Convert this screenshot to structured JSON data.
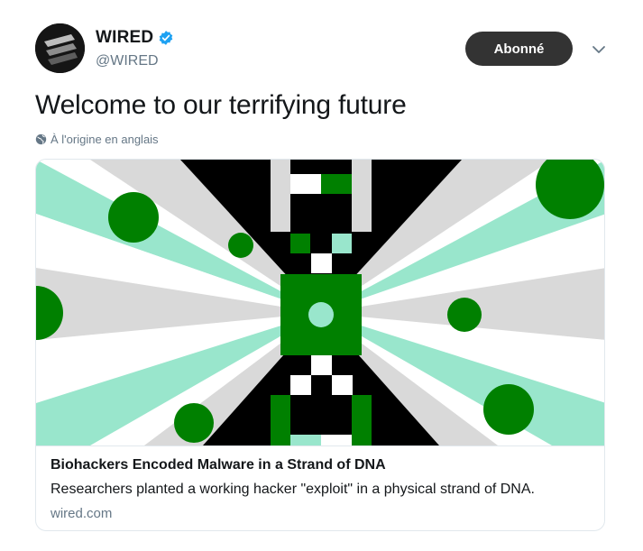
{
  "author": {
    "name": "WIRED",
    "handle": "@WIRED",
    "verified_color": "#1da1f2"
  },
  "follow_button": {
    "label": "Abonné"
  },
  "tweet": {
    "text": "Welcome to our terrifying future",
    "translation_label": "À l'origine en anglais"
  },
  "card": {
    "title": "Biohackers Encoded Malware in a Strand of DNA",
    "description": "Researchers planted a working hacker \"exploit\" in a physical strand of DNA.",
    "domain": "wired.com"
  },
  "colors": {
    "dark_green": "#008000",
    "mint": "#99e6cc",
    "gray": "#d9d9d9",
    "black": "#000000"
  },
  "icons": [
    "wired-logo",
    "verified-badge-icon",
    "chevron-down-icon",
    "globe-icon"
  ]
}
